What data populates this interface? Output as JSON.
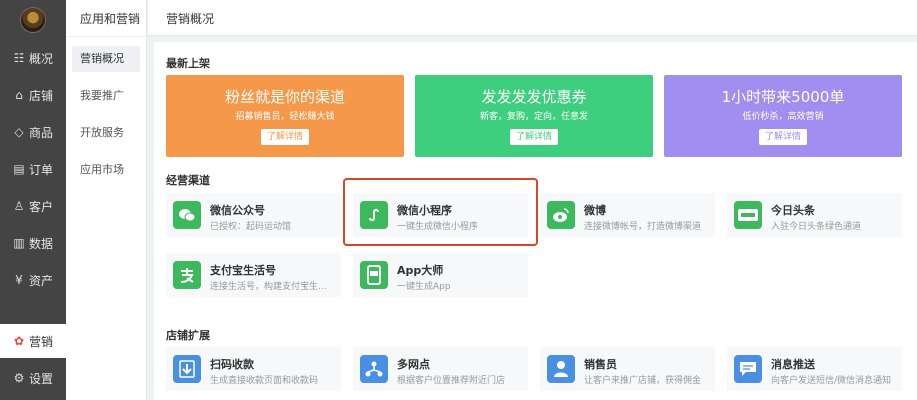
{
  "sidebar": {
    "items": [
      {
        "icon": "chat-icon",
        "glyph": "☷",
        "label": "概况"
      },
      {
        "icon": "store-icon",
        "glyph": "⌂",
        "label": "店铺"
      },
      {
        "icon": "tag-icon",
        "glyph": "◇",
        "label": "商品"
      },
      {
        "icon": "order-icon",
        "glyph": "▤",
        "label": "订单"
      },
      {
        "icon": "user-icon",
        "glyph": "♙",
        "label": "客户"
      },
      {
        "icon": "chart-icon",
        "glyph": "▥",
        "label": "数据"
      },
      {
        "icon": "money-icon",
        "glyph": "¥",
        "label": "资产"
      },
      {
        "icon": "marketing-icon",
        "glyph": "✿",
        "label": "营销"
      },
      {
        "icon": "gear-icon",
        "glyph": "⚙",
        "label": "设置"
      }
    ]
  },
  "subnav": {
    "title": "应用和营销",
    "items": [
      "营销概况",
      "我要推广",
      "开放服务",
      "应用市场"
    ]
  },
  "header": {
    "title": "营销概况"
  },
  "new_arrivals": {
    "title": "最新上架",
    "banners": [
      {
        "title": "粉丝就是你的渠道",
        "subtitle": "招募销售员，轻松赚大钱",
        "button": "了解详情",
        "color": "#f6984a"
      },
      {
        "title": "发发发发优惠券",
        "subtitle": "新客，复购，定向，任意发",
        "button": "了解详情",
        "color": "#3dcf7d"
      },
      {
        "title": "1小时带来5000单",
        "subtitle": "低价秒杀，高效营销",
        "button": "了解详情",
        "color": "#a08ef0"
      }
    ]
  },
  "channels": {
    "title": "经营渠道",
    "cards": [
      {
        "icon": "wechat-icon",
        "title": "微信公众号",
        "desc": "已授权：起码运动馆",
        "color": "#3cb95d"
      },
      {
        "icon": "miniprogram-icon",
        "title": "微信小程序",
        "desc": "一键生成微信小程序",
        "color": "#3cb95d"
      },
      {
        "icon": "weibo-icon",
        "title": "微博",
        "desc": "连接微博帐号，打造微博渠道",
        "color": "#3cb95d"
      },
      {
        "icon": "toutiao-icon",
        "title": "今日头条",
        "desc": "入驻今日头条绿色通道",
        "color": "#3cb95d"
      },
      {
        "icon": "alipay-icon",
        "title": "支付宝生活号",
        "desc": "连接生活号，构建支付宝生...",
        "color": "#3cb95d"
      },
      {
        "icon": "app-icon",
        "title": "App大师",
        "desc": "一键生成App",
        "color": "#3cb95d"
      }
    ]
  },
  "store_ext": {
    "title": "店铺扩展",
    "cards": [
      {
        "icon": "qr-collect-icon",
        "title": "扫码收款",
        "desc": "生成直接收款页面和收款码",
        "color": "#4a90e2"
      },
      {
        "icon": "multi-store-icon",
        "title": "多网点",
        "desc": "根据客户位置推荐附近门店",
        "color": "#4a90e2"
      },
      {
        "icon": "salesperson-icon",
        "title": "销售员",
        "desc": "让客户来推广店铺，获得佣金",
        "color": "#4a90e2"
      },
      {
        "icon": "message-push-icon",
        "title": "消息推送",
        "desc": "向客户发送短信/微信消息通知",
        "color": "#4a90e2"
      }
    ]
  }
}
